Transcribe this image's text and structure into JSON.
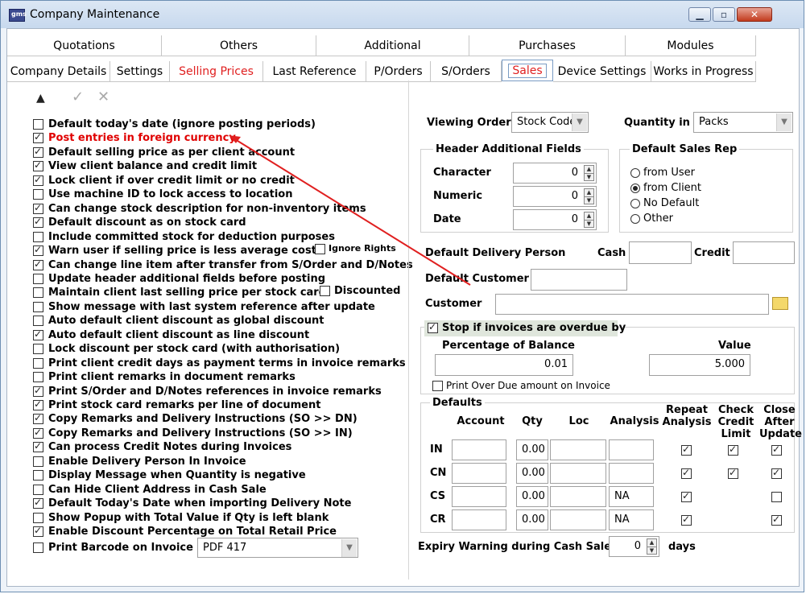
{
  "window": {
    "title": "Company Maintenance",
    "app_icon": "gms"
  },
  "tabs_row1": [
    "Quotations",
    "Others",
    "Additional",
    "Purchases",
    "Modules"
  ],
  "tabs_row2": [
    "Company Details",
    "Settings",
    "Selling Prices",
    "Last Reference",
    "P/Orders",
    "S/Orders",
    "Sales",
    "Device Settings",
    "Works in Progress"
  ],
  "active_tab": "Sales",
  "toolbar": {
    "up": "▲",
    "ok": "✓",
    "cancel": "✕"
  },
  "options": [
    {
      "label": "Default today's date (ignore posting periods)",
      "checked": false
    },
    {
      "label": "Post entries in foreign currency",
      "checked": true,
      "highlight": true
    },
    {
      "label": "Default selling price as per client account",
      "checked": true
    },
    {
      "label": "View client balance and credit limit",
      "checked": true
    },
    {
      "label": "Lock client if over credit limit or no credit",
      "checked": true
    },
    {
      "label": "Use machine ID to lock access to location",
      "checked": false
    },
    {
      "label": "Can change stock description for non-inventory items",
      "checked": true
    },
    {
      "label": "Default discount as on stock card",
      "checked": true
    },
    {
      "label": "Include committed stock for deduction purposes",
      "checked": false
    },
    {
      "label": "Warn user if selling price is less average cost",
      "checked": true
    },
    {
      "label": "Can change line item after transfer from S/Order and D/Notes",
      "checked": true
    },
    {
      "label": "Update header additional fields before posting",
      "checked": false
    },
    {
      "label": "Maintain client last selling price per stock card",
      "checked": false
    },
    {
      "label": "Show message with last system reference after update",
      "checked": false
    },
    {
      "label": "Auto default client discount as global discount",
      "checked": false
    },
    {
      "label": "Auto default client discount as line discount",
      "checked": true
    },
    {
      "label": "Lock discount per stock card (with authorisation)",
      "checked": false
    },
    {
      "label": "Print client credit days as payment terms in invoice remarks",
      "checked": false
    },
    {
      "label": "Print client remarks in document remarks",
      "checked": false
    },
    {
      "label": "Print S/Order and D/Notes references in invoice remarks",
      "checked": true
    },
    {
      "label": "Print stock card remarks per line of document",
      "checked": true
    },
    {
      "label": "Copy Remarks and Delivery Instructions (SO >> DN)",
      "checked": true
    },
    {
      "label": "Copy Remarks and Delivery Instructions (SO >> IN)",
      "checked": true
    },
    {
      "label": "Can process Credit Notes during Invoices",
      "checked": true
    },
    {
      "label": "Enable Delivery Person In Invoice",
      "checked": false
    },
    {
      "label": "Display Message when Quantity is negative",
      "checked": false
    },
    {
      "label": "Can Hide Client Address in Cash Sale",
      "checked": false
    },
    {
      "label": "Default Today's Date when importing Delivery Note",
      "checked": true
    },
    {
      "label": "Show Popup with Total Value if Qty is left blank",
      "checked": false
    },
    {
      "label": "Enable Discount Percentage on Total Retail Price",
      "checked": true
    }
  ],
  "extra": {
    "ignore_rights": "Ignore Rights",
    "discounted": "Discounted"
  },
  "barcode": {
    "label": "Print Barcode on Invoice",
    "value": "PDF 417"
  },
  "viewing_order": {
    "label": "Viewing Order",
    "value": "Stock Code"
  },
  "quantity_in": {
    "label": "Quantity in",
    "value": "Packs"
  },
  "header_fields": {
    "title": "Header Additional Fields",
    "rows": [
      {
        "label": "Character",
        "value": "0"
      },
      {
        "label": "Numeric",
        "value": "0"
      },
      {
        "label": "Date",
        "value": "0"
      }
    ]
  },
  "sales_rep": {
    "title": "Default Sales Rep",
    "options": [
      "from User",
      "from Client",
      "No Default",
      "Other"
    ],
    "selected": "from Client"
  },
  "delivery": {
    "label": "Default Delivery Person",
    "cash": "Cash",
    "credit": "Credit"
  },
  "default_customer": "Default Customer",
  "customer": "Customer",
  "overdue": {
    "label": "Stop if invoices are overdue by",
    "pct_label": "Percentage of Balance",
    "pct_value": "0.01",
    "value_label": "Value",
    "value": "5.000",
    "print_label": "Print Over Due amount on Invoice"
  },
  "defaults": {
    "title": "Defaults",
    "headers": [
      "Account",
      "Qty",
      "Loc",
      "Analysis",
      "Repeat Analysis",
      "Check Credit Limit",
      "Close After Update"
    ],
    "rows": [
      {
        "code": "IN",
        "qty": "0.00",
        "analysis": "",
        "repeat": true,
        "check": true,
        "close": true
      },
      {
        "code": "CN",
        "qty": "0.00",
        "analysis": "",
        "repeat": true,
        "check": true,
        "close": true
      },
      {
        "code": "CS",
        "qty": "0.00",
        "analysis": "NA",
        "repeat": true,
        "check": null,
        "close": false
      },
      {
        "code": "CR",
        "qty": "0.00",
        "analysis": "NA",
        "repeat": true,
        "check": null,
        "close": true
      }
    ]
  },
  "expiry": {
    "label": "Expiry Warning during Cash Sale",
    "value": "0",
    "unit": "days"
  }
}
